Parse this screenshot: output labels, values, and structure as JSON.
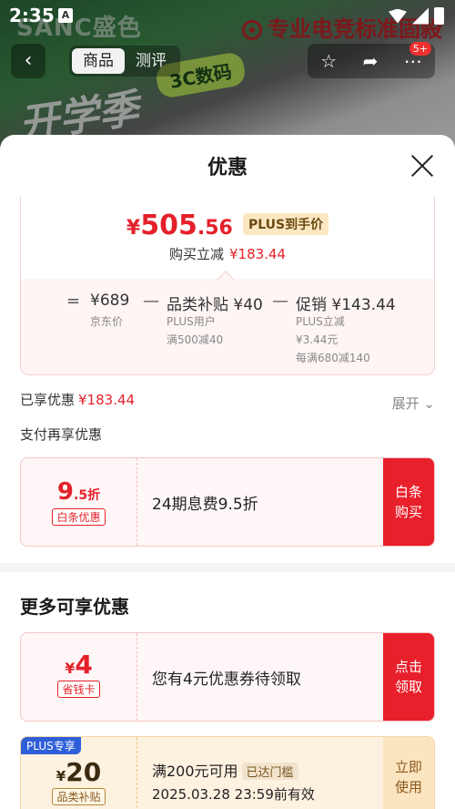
{
  "status_bar": {
    "time": "2:35",
    "notif_icon": "A"
  },
  "background": {
    "brand_left": "SANC盛色",
    "brand_right": "专业电竞标准固殺",
    "hero_text": "开学季",
    "badge": "3C数码",
    "nav": {
      "back_icon": "‹",
      "tabs": [
        "商品",
        "测评"
      ],
      "active_tab": 0,
      "msg_badge": "5+"
    }
  },
  "sheet": {
    "title": "优惠",
    "price": {
      "yen": "¥",
      "integer": "505",
      "decimal": ".56",
      "plus_tag": "PLUS到手价",
      "instant_label": "购买立减",
      "instant_amount": "¥183.44"
    },
    "breakdown": {
      "eq": "=",
      "minus": "—",
      "base_price": "¥689",
      "base_label": "京东价",
      "subsidy_title": "品类补贴 ¥40",
      "subsidy_sub1": "PLUS用户",
      "subsidy_sub2": "满500减40",
      "promo_title": "促销 ¥143.44",
      "promo_sub1": "PLUS立减",
      "promo_sub2": "¥3.44元",
      "promo_sub3": "每满680减140"
    },
    "enjoyed_label": "已享优惠",
    "enjoyed_amount": "¥183.44",
    "expand_label": "展开",
    "pay_more_label": "支付再享优惠",
    "baitiao": {
      "discount_big": "9",
      "discount_small": ".5折",
      "tag": "白条优惠",
      "desc": "24期息费9.5折",
      "action_line1": "白条",
      "action_line2": "购买"
    },
    "more_title": "更多可享优惠",
    "savings_card": {
      "yen": "¥",
      "amount": "4",
      "tag": "省钱卡",
      "desc": "您有4元优惠券待领取",
      "action_line1": "点击",
      "action_line2": "领取"
    },
    "plus_coupon": {
      "corner": "PLUS专享",
      "yen": "¥",
      "amount": "20",
      "tag": "品类补贴",
      "desc": "满200元可用",
      "door_tag": "已达门槛",
      "expiry": "2025.03.28 23:59前有效",
      "action_line1": "立即",
      "action_line2": "使用"
    }
  },
  "colors": {
    "accent_red": "#e4212b",
    "plus_gold": "#fbe8c2",
    "plus_blue": "#2f5fd8"
  }
}
